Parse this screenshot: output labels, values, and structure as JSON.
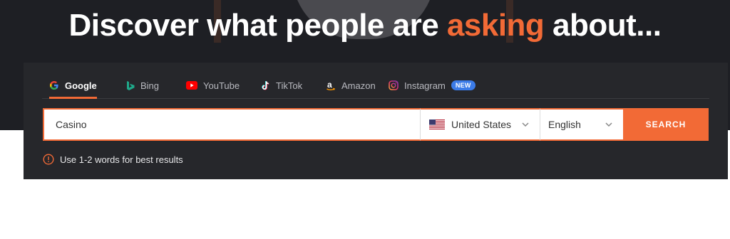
{
  "headline": {
    "part1": "Discover what people are ",
    "accent": "asking",
    "part2": " about..."
  },
  "tabs": [
    {
      "label": "Google",
      "icon": "google-icon",
      "active": true
    },
    {
      "label": "Bing",
      "icon": "bing-icon",
      "active": false
    },
    {
      "label": "YouTube",
      "icon": "youtube-icon",
      "active": false
    },
    {
      "label": "TikTok",
      "icon": "tiktok-icon",
      "active": false
    },
    {
      "label": "Amazon",
      "icon": "amazon-icon",
      "active": false
    },
    {
      "label": "Instagram",
      "icon": "instagram-icon",
      "active": false,
      "badge": "NEW"
    }
  ],
  "search": {
    "value": "Casino",
    "button_label": "SEARCH"
  },
  "country": {
    "label": "United States",
    "flag": "us-flag-icon"
  },
  "language": {
    "label": "English"
  },
  "hint": "Use 1-2 words for best results",
  "colors": {
    "accent": "#f26a36",
    "panel": "#26272b",
    "hero_bg": "#1e1f24",
    "badge": "#3b7be8"
  }
}
